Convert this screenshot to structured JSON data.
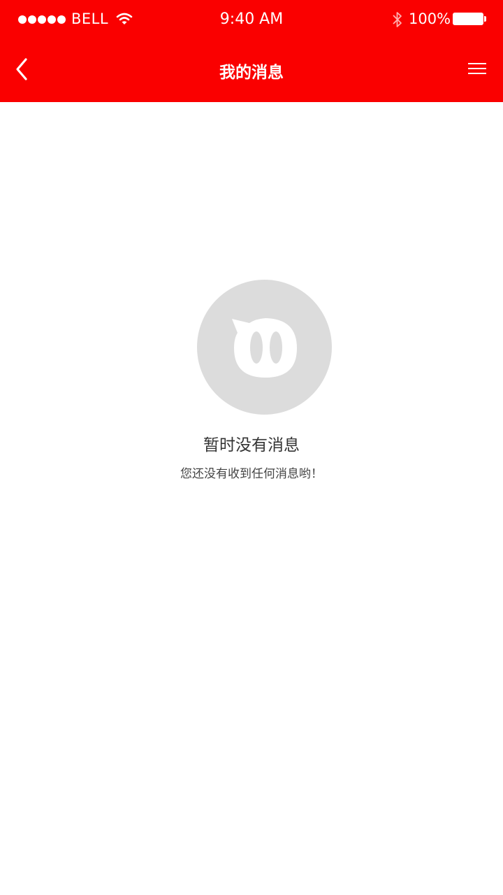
{
  "status_bar": {
    "carrier": "BELL",
    "time": "9:40 AM",
    "battery_percent": "100%",
    "signal_icon": "signal-dots-icon",
    "wifi_icon": "wifi-icon",
    "bluetooth_icon": "bluetooth-icon",
    "battery_icon": "battery-icon"
  },
  "header": {
    "title": "我的消息",
    "back_icon": "chevron-left-icon",
    "menu_icon": "hamburger-menu-icon",
    "background_color": "#fa0000"
  },
  "empty_state": {
    "icon": "empty-message-mascot-icon",
    "title": "暂时没有消息",
    "subtitle": "您还没有收到任何消息哟！"
  }
}
